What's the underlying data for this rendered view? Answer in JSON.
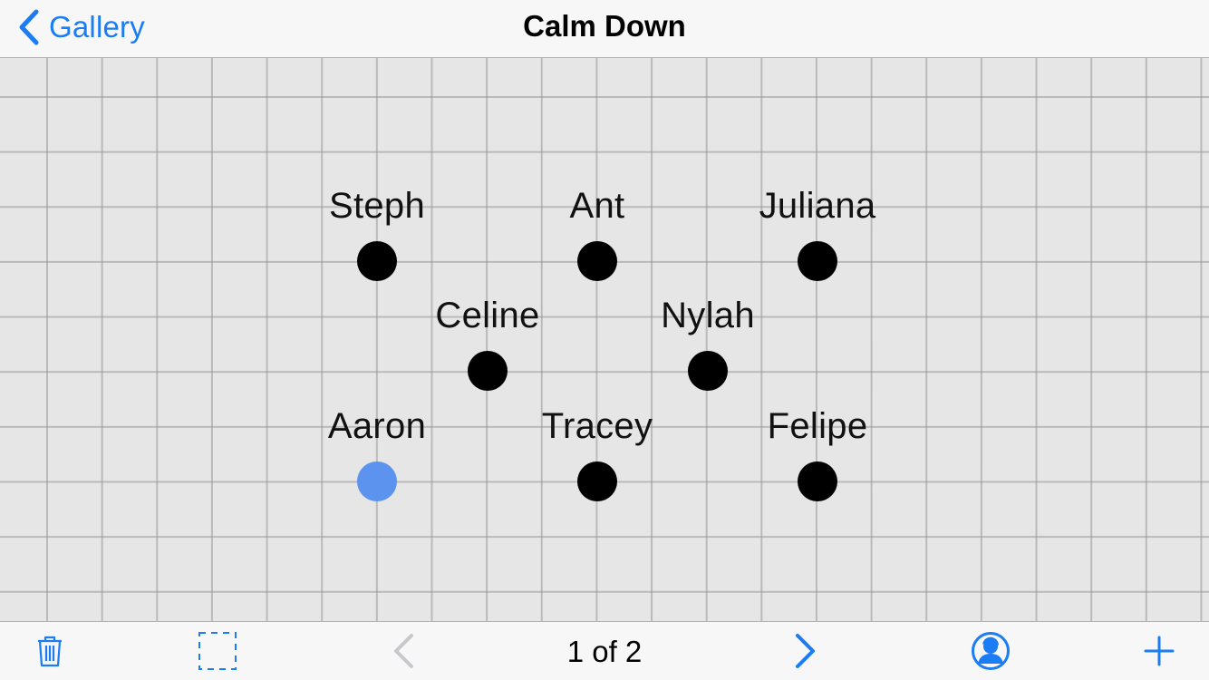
{
  "navbar": {
    "back_label": "Gallery",
    "title": "Calm Down"
  },
  "seats": [
    {
      "name": "Steph",
      "selected": false
    },
    {
      "name": "Ant",
      "selected": false
    },
    {
      "name": "Juliana",
      "selected": false
    },
    {
      "name": "Celine",
      "selected": false
    },
    {
      "name": "Nylah",
      "selected": false
    },
    {
      "name": "Aaron",
      "selected": true
    },
    {
      "name": "Tracey",
      "selected": false
    },
    {
      "name": "Felipe",
      "selected": false
    }
  ],
  "toolbar": {
    "page_indicator": "1 of 2",
    "icons": [
      "trash-icon",
      "selection-box-icon",
      "chevron-left-icon",
      "chevron-right-icon",
      "student-profile-icon",
      "plus-icon"
    ]
  },
  "colors": {
    "accent": "#1b7cf4",
    "selected_seat": "#5c93ee",
    "seat": "#000000",
    "disabled": "#c7c7cc"
  }
}
